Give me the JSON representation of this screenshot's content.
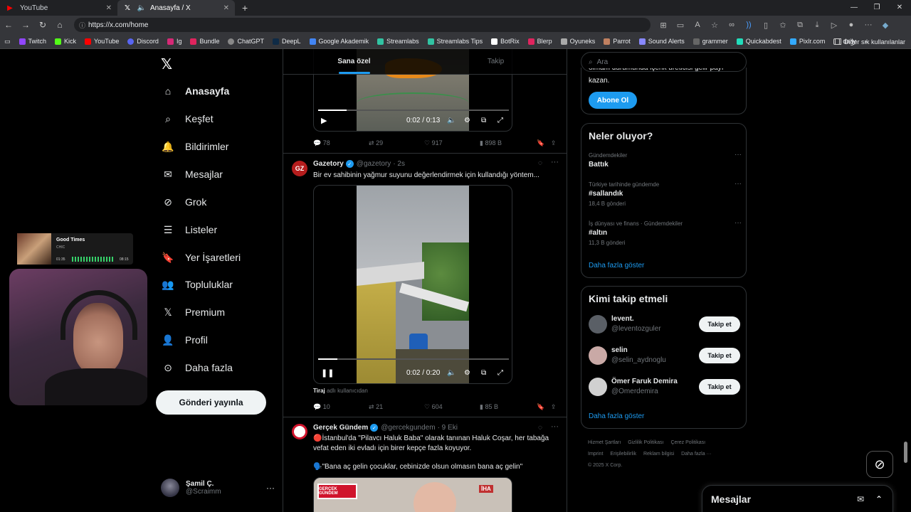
{
  "browser": {
    "tabs": [
      {
        "title": "YouTube",
        "active": false
      },
      {
        "title": "Anasayfa / X",
        "active": true
      }
    ],
    "url": "https://x.com/home",
    "bookmarks": [
      "Twitch",
      "Kick",
      "YouTube",
      "Discord",
      "Ig",
      "Bundle",
      "ChatGPT",
      "DeepL",
      "Google Akademik",
      "Streamlabs",
      "Streamlabs Tips",
      "BotRix",
      "Blerp",
      "Oyuneks",
      "Parrot",
      "Sound Alerts",
      "grammer",
      "Quickabdest",
      "Pixlr.com",
      "daily"
    ],
    "other_bookmarks": "Diğer sık kullanılanlar"
  },
  "nav": {
    "items": [
      {
        "label": "Anasayfa",
        "icon": "home-icon",
        "active": true
      },
      {
        "label": "Keşfet",
        "icon": "search-icon"
      },
      {
        "label": "Bildirimler",
        "icon": "bell-icon"
      },
      {
        "label": "Mesajlar",
        "icon": "mail-icon"
      },
      {
        "label": "Grok",
        "icon": "grok-icon"
      },
      {
        "label": "Listeler",
        "icon": "list-icon"
      },
      {
        "label": "Yer İşaretleri",
        "icon": "bookmark-icon"
      },
      {
        "label": "Topluluklar",
        "icon": "people-icon"
      },
      {
        "label": "Premium",
        "icon": "x-logo-icon"
      },
      {
        "label": "Profil",
        "icon": "person-icon"
      },
      {
        "label": "Daha fazla",
        "icon": "more-circle-icon"
      }
    ],
    "post_button": "Gönderi yayınla",
    "user": {
      "name": "Şamil Ç.",
      "handle": "@Scraimm"
    }
  },
  "feed": {
    "tabs": [
      "Sana özel",
      "Takip"
    ],
    "post1": {
      "video_time": "0:02 / 0:13",
      "progress": 0.15,
      "replies": "78",
      "reposts": "29",
      "likes": "917",
      "views": "898 B"
    },
    "post2": {
      "name": "Gazetory",
      "handle": "@gazetory",
      "time": "· 2s",
      "text": "Bir ev sahibinin yağmur suyunu değerlendirmek için kullandığı yöntem...",
      "video_time": "0:02 / 0:20",
      "progress": 0.1,
      "source_label": "Tiraj",
      "source_text": "adlı kullanıcıdan",
      "replies": "10",
      "reposts": "21",
      "likes": "604",
      "views": "85 B"
    },
    "post3": {
      "name": "Gerçek Gündem",
      "handle": "@gercekgundem",
      "time": "· 9 Eki",
      "text1": "🔴İstanbul'da \"Pilavcı Haluk Baba\" olarak tanınan Haluk Coşar, her tabağa vefat eden iki evladı için birer kepçe fazla koyuyor.",
      "text2": "🗣️\"Bana aç gelin çocuklar, cebinizde olsun olmasın bana aç gelin\"",
      "badge": "GERÇEK GÜNDEM",
      "iha": "İHA"
    }
  },
  "sidebar": {
    "search_placeholder": "Ara",
    "premium_text": "kazan.",
    "premium_cut": "olmam durumunda içerik üreticisi gelir payı",
    "subscribe_button": "Abone Ol",
    "trends_title": "Neler oluyor?",
    "trends": [
      {
        "meta": "Gündemdekiler",
        "name": "Battık",
        "count": ""
      },
      {
        "meta": "Türkiye tarihinde gündemde",
        "name": "#sallandık",
        "count": "18,4 B gönderi"
      },
      {
        "meta": "İş dünyası ve finans · Gündemdekiler",
        "name": "#altın",
        "count": "11,3 B gönderi"
      }
    ],
    "trends_more": "Daha fazla göster",
    "follow_title": "Kimi takip etmeli",
    "follow": [
      {
        "name": "levent.",
        "handle": "@leventozguler",
        "button": "Takip et"
      },
      {
        "name": "selin",
        "handle": "@selin_aydnoglu",
        "button": "Takip et"
      },
      {
        "name": "Ömer Faruk Demira",
        "handle": "@Omerdemira",
        "button": "Takip et"
      }
    ],
    "follow_more": "Daha fazla göster",
    "footer": [
      "Hizmet Şartları",
      "Gizlilik Politikası",
      "Çerez Politikası",
      "Imprint",
      "Erişilebilirlik",
      "Reklam bilgisi",
      "Daha fazla ···",
      "© 2025 X Corp."
    ],
    "messages": "Mesajlar"
  },
  "overlay": {
    "song": "Good Times",
    "artist": "CHIC",
    "elapsed": "01:35",
    "total": "08:15"
  }
}
